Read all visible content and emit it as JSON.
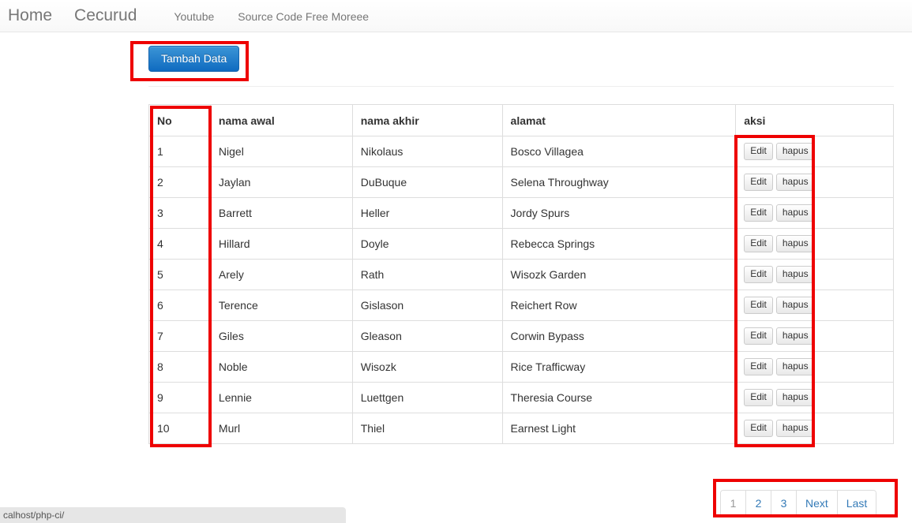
{
  "navbar": {
    "brand_primary": "Home",
    "brand_secondary": "Cecurud",
    "links": [
      {
        "label": "Youtube"
      },
      {
        "label": "Source Code Free Moreee"
      }
    ]
  },
  "toolbar": {
    "add_label": "Tambah Data"
  },
  "table": {
    "headers": {
      "no": "No",
      "nama_awal": "nama awal",
      "nama_akhir": "nama akhir",
      "alamat": "alamat",
      "aksi": "aksi"
    },
    "action_labels": {
      "edit": "Edit",
      "delete": "hapus"
    },
    "rows": [
      {
        "no": "1",
        "nama_awal": "Nigel",
        "nama_akhir": "Nikolaus",
        "alamat": "Bosco Villagea"
      },
      {
        "no": "2",
        "nama_awal": "Jaylan",
        "nama_akhir": "DuBuque",
        "alamat": "Selena Throughway"
      },
      {
        "no": "3",
        "nama_awal": "Barrett",
        "nama_akhir": "Heller",
        "alamat": "Jordy Spurs"
      },
      {
        "no": "4",
        "nama_awal": "Hillard",
        "nama_akhir": "Doyle",
        "alamat": "Rebecca Springs"
      },
      {
        "no": "5",
        "nama_awal": "Arely",
        "nama_akhir": "Rath",
        "alamat": "Wisozk Garden"
      },
      {
        "no": "6",
        "nama_awal": "Terence",
        "nama_akhir": "Gislason",
        "alamat": "Reichert Row"
      },
      {
        "no": "7",
        "nama_awal": "Giles",
        "nama_akhir": "Gleason",
        "alamat": "Corwin Bypass"
      },
      {
        "no": "8",
        "nama_awal": "Noble",
        "nama_akhir": "Wisozk",
        "alamat": "Rice Trafficway"
      },
      {
        "no": "9",
        "nama_awal": "Lennie",
        "nama_akhir": "Luettgen",
        "alamat": "Theresia Course"
      },
      {
        "no": "10",
        "nama_awal": "Murl",
        "nama_akhir": "Thiel",
        "alamat": "Earnest Light"
      }
    ]
  },
  "pagination": {
    "items": [
      {
        "label": "1",
        "active": true
      },
      {
        "label": "2",
        "active": false
      },
      {
        "label": "3",
        "active": false
      },
      {
        "label": "Next",
        "active": false
      },
      {
        "label": "Last",
        "active": false
      }
    ]
  },
  "statusbar": {
    "url": "calhost/php-ci/"
  },
  "colors": {
    "annotation": "#ee0000",
    "primary_button": "#1f7ec9",
    "link": "#337ab7",
    "nav_text": "#777777",
    "table_border": "#dddddd"
  }
}
